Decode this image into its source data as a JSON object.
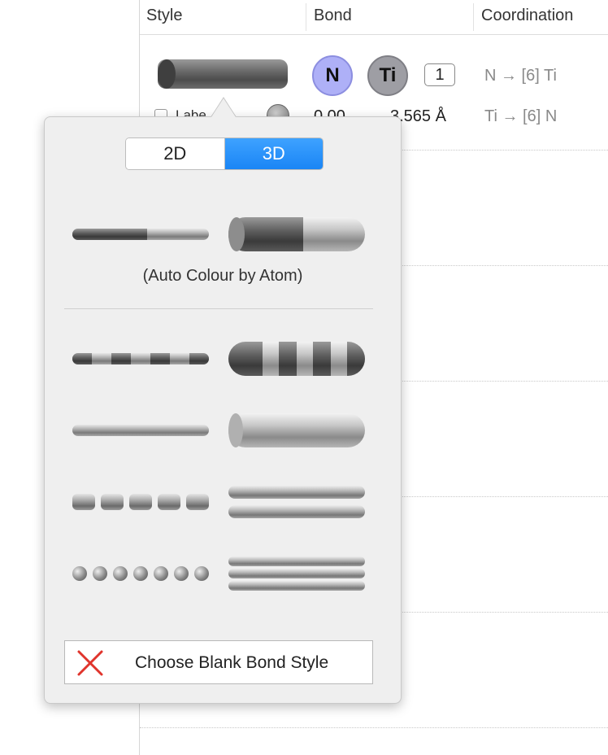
{
  "header": {
    "style_label": "Style",
    "bond_label": "Bond",
    "coordination_label": "Coordination"
  },
  "bond_row": {
    "atom1": "N",
    "atom2": "Ti",
    "bond_order": "1",
    "coordination_1": "N → [6] Ti",
    "coordination_2": "Ti → [6] N",
    "label_checkbox": "Labe",
    "min_distance": "0.00",
    "max_distance": "3.565 Å"
  },
  "popover": {
    "mode_2d": "2D",
    "mode_3d": "3D",
    "selected_mode": "3D",
    "auto_colour_label": "(Auto Colour by Atom)",
    "blank_button_label": "Choose Blank Bond Style",
    "styles": [
      "auto-colour",
      "striped",
      "solid",
      "dashed-cylinders",
      "double",
      "beads",
      "triple"
    ],
    "icons": [
      "red-x-icon"
    ]
  },
  "colors": {
    "accent": "#1a85f5",
    "atom_n": "#aeb0f7",
    "atom_ti": "#9e9ea4",
    "blank_x": "#e0342c"
  }
}
